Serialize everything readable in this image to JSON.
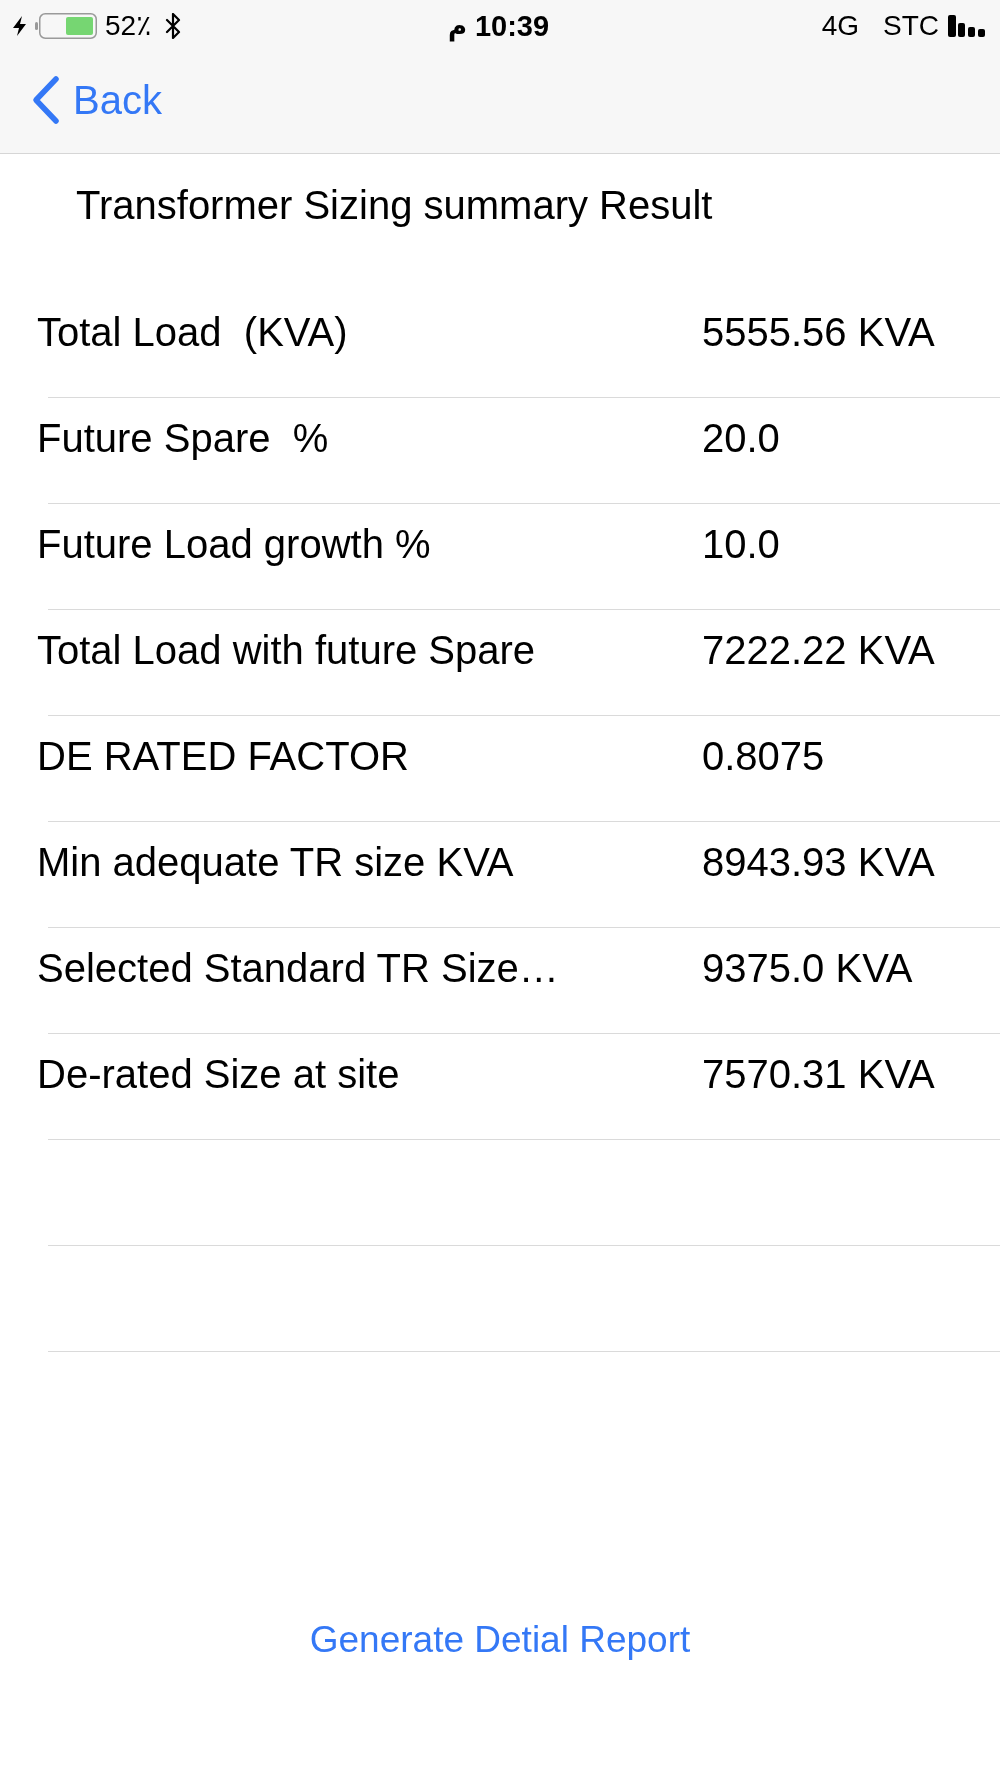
{
  "status_bar": {
    "battery_text": "52٪",
    "period": "م",
    "time": "10:39",
    "network": "4G",
    "carrier": "STC"
  },
  "nav_bar": {
    "back_label": "Back"
  },
  "title": "Transformer Sizing summary Result",
  "rows": [
    {
      "kind": "entry",
      "label": "Total Load  (KVA)",
      "value": "5555.56 KVA"
    },
    {
      "kind": "entry",
      "label": "Future Spare  %",
      "value": "20.0"
    },
    {
      "kind": "entry",
      "label": "Future Load growth %",
      "value": "10.0"
    },
    {
      "kind": "entry",
      "label": "Total Load with future Spare",
      "value": "7222.22 KVA"
    },
    {
      "kind": "entry",
      "label": "DE RATED FACTOR",
      "value": "0.8075"
    },
    {
      "kind": "entry",
      "label": "Min adequate TR size KVA",
      "value": "8943.93 KVA"
    },
    {
      "kind": "entry",
      "label": "Selected Standard TR Size…",
      "value": "9375.0 KVA"
    },
    {
      "kind": "entry",
      "label": "De-rated Size at site",
      "value": "7570.31 KVA"
    },
    {
      "kind": "blank"
    },
    {
      "kind": "blank"
    }
  ],
  "action": {
    "label": "Generate Detial Report"
  }
}
